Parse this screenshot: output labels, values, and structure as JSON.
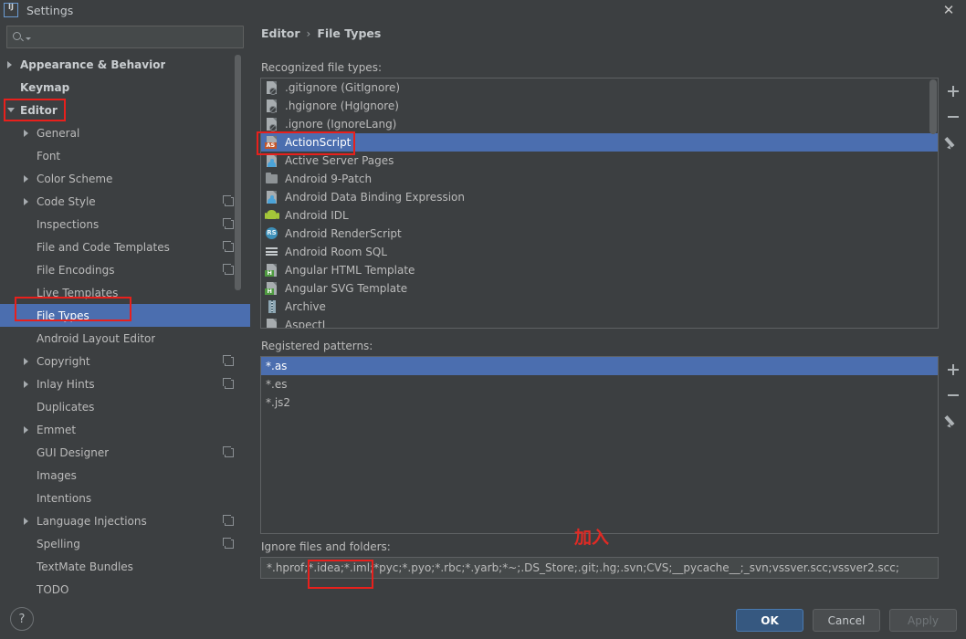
{
  "window": {
    "title": "Settings",
    "logo_text": "IJ",
    "close_label": "✕"
  },
  "search": {
    "value": "",
    "placeholder": ""
  },
  "sidebar": {
    "items": [
      {
        "label": "Appearance & Behavior",
        "arrow": "right",
        "indent": 0,
        "bold": true,
        "selected": false,
        "copy": false
      },
      {
        "label": "Keymap",
        "arrow": "none",
        "indent": 0,
        "bold": true,
        "selected": false,
        "copy": false
      },
      {
        "label": "Editor",
        "arrow": "down",
        "indent": 0,
        "bold": true,
        "selected": false,
        "copy": false
      },
      {
        "label": "General",
        "arrow": "right",
        "indent": 1,
        "bold": false,
        "selected": false,
        "copy": false
      },
      {
        "label": "Font",
        "arrow": "none",
        "indent": 1,
        "bold": false,
        "selected": false,
        "copy": false
      },
      {
        "label": "Color Scheme",
        "arrow": "right",
        "indent": 1,
        "bold": false,
        "selected": false,
        "copy": false
      },
      {
        "label": "Code Style",
        "arrow": "right",
        "indent": 1,
        "bold": false,
        "selected": false,
        "copy": true
      },
      {
        "label": "Inspections",
        "arrow": "none",
        "indent": 1,
        "bold": false,
        "selected": false,
        "copy": true
      },
      {
        "label": "File and Code Templates",
        "arrow": "none",
        "indent": 1,
        "bold": false,
        "selected": false,
        "copy": true
      },
      {
        "label": "File Encodings",
        "arrow": "none",
        "indent": 1,
        "bold": false,
        "selected": false,
        "copy": true
      },
      {
        "label": "Live Templates",
        "arrow": "none",
        "indent": 1,
        "bold": false,
        "selected": false,
        "copy": false
      },
      {
        "label": "File Types",
        "arrow": "none",
        "indent": 1,
        "bold": false,
        "selected": true,
        "copy": false
      },
      {
        "label": "Android Layout Editor",
        "arrow": "none",
        "indent": 1,
        "bold": false,
        "selected": false,
        "copy": false
      },
      {
        "label": "Copyright",
        "arrow": "right",
        "indent": 1,
        "bold": false,
        "selected": false,
        "copy": true
      },
      {
        "label": "Inlay Hints",
        "arrow": "right",
        "indent": 1,
        "bold": false,
        "selected": false,
        "copy": true
      },
      {
        "label": "Duplicates",
        "arrow": "none",
        "indent": 1,
        "bold": false,
        "selected": false,
        "copy": false
      },
      {
        "label": "Emmet",
        "arrow": "right",
        "indent": 1,
        "bold": false,
        "selected": false,
        "copy": false
      },
      {
        "label": "GUI Designer",
        "arrow": "none",
        "indent": 1,
        "bold": false,
        "selected": false,
        "copy": true
      },
      {
        "label": "Images",
        "arrow": "none",
        "indent": 1,
        "bold": false,
        "selected": false,
        "copy": false
      },
      {
        "label": "Intentions",
        "arrow": "none",
        "indent": 1,
        "bold": false,
        "selected": false,
        "copy": false
      },
      {
        "label": "Language Injections",
        "arrow": "right",
        "indent": 1,
        "bold": false,
        "selected": false,
        "copy": true
      },
      {
        "label": "Spelling",
        "arrow": "none",
        "indent": 1,
        "bold": false,
        "selected": false,
        "copy": true
      },
      {
        "label": "TextMate Bundles",
        "arrow": "none",
        "indent": 1,
        "bold": false,
        "selected": false,
        "copy": false
      },
      {
        "label": "TODO",
        "arrow": "none",
        "indent": 1,
        "bold": false,
        "selected": false,
        "copy": false
      }
    ]
  },
  "breadcrumb": {
    "parent": "Editor",
    "separator": "›",
    "current": "File Types"
  },
  "recognized": {
    "label": "Recognized file types:",
    "rows": [
      {
        "name": ".gitignore (GitIgnore)",
        "icon": "file-ban",
        "selected": false
      },
      {
        "name": ".hgignore (HgIgnore)",
        "icon": "file-ban",
        "selected": false
      },
      {
        "name": ".ignore (IgnoreLang)",
        "icon": "file-ban",
        "selected": false
      },
      {
        "name": "ActionScript",
        "icon": "file-as",
        "selected": true
      },
      {
        "name": "Active Server Pages",
        "icon": "file-person",
        "selected": false
      },
      {
        "name": "Android 9-Patch",
        "icon": "folder",
        "selected": false
      },
      {
        "name": "Android Data Binding Expression",
        "icon": "file-person",
        "selected": false
      },
      {
        "name": "Android IDL",
        "icon": "android",
        "selected": false
      },
      {
        "name": "Android RenderScript",
        "icon": "circle-rs",
        "selected": false
      },
      {
        "name": "Android Room SQL",
        "icon": "lines",
        "selected": false
      },
      {
        "name": "Angular HTML Template",
        "icon": "file-h",
        "selected": false
      },
      {
        "name": "Angular SVG Template",
        "icon": "file-h",
        "selected": false
      },
      {
        "name": "Archive",
        "icon": "archive",
        "selected": false
      },
      {
        "name": "AspectJ",
        "icon": "file-plain",
        "selected": false
      }
    ],
    "toolbar": {
      "add": "+",
      "remove": "−",
      "edit": "pencil"
    }
  },
  "patterns": {
    "label": "Registered patterns:",
    "rows": [
      {
        "value": "*.as",
        "selected": true
      },
      {
        "value": "*.es",
        "selected": false
      },
      {
        "value": "*.js2",
        "selected": false
      }
    ],
    "toolbar": {
      "add": "+",
      "remove": "−",
      "edit": "pencil"
    }
  },
  "ignore": {
    "label": "Ignore files and folders:",
    "value": "*.hprof;*.idea;*.iml;*pyc;*.pyo;*.rbc;*.yarb;*~;.DS_Store;.git;.hg;.svn;CVS;__pycache__;_svn;vssver.scc;vssver2.scc;"
  },
  "annotation": {
    "note_cn": "加入",
    "highlight_color": "#e8201c"
  },
  "footer": {
    "help": "?",
    "ok": "OK",
    "cancel": "Cancel",
    "apply": "Apply"
  }
}
